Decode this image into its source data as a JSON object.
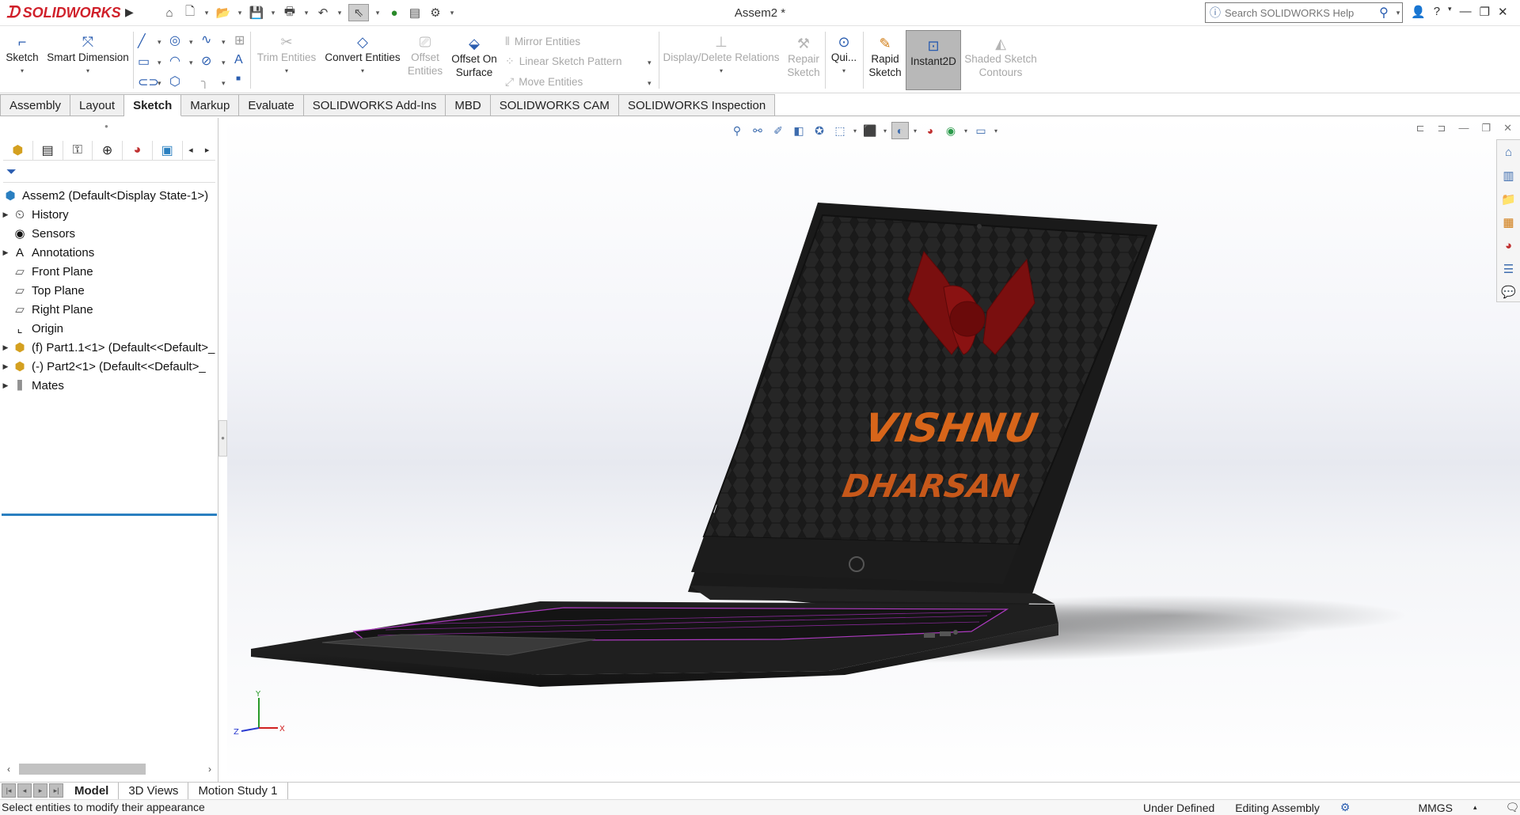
{
  "app": {
    "brand": "SOLIDWORKS",
    "document_title": "Assem2 *"
  },
  "search": {
    "placeholder": "Search SOLIDWORKS Help"
  },
  "ribbon": {
    "sketch": "Sketch",
    "smart_dimension": "Smart Dimension",
    "trim_entities": "Trim Entities",
    "convert_entities": "Convert Entities",
    "offset_entities": "Offset Entities",
    "offset_on_surface": "Offset On Surface",
    "mirror_entities": "Mirror Entities",
    "linear_sketch_pattern": "Linear Sketch Pattern",
    "move_entities": "Move Entities",
    "display_delete_relations": "Display/Delete Relations",
    "repair_sketch": "Repair Sketch",
    "quick_snaps": "Qui...",
    "rapid_sketch": "Rapid Sketch",
    "instant2d": "Instant2D",
    "shaded_sketch_contours": "Shaded Sketch Contours"
  },
  "tabs": [
    "Assembly",
    "Layout",
    "Sketch",
    "Markup",
    "Evaluate",
    "SOLIDWORKS Add-Ins",
    "MBD",
    "SOLIDWORKS CAM",
    "SOLIDWORKS Inspection"
  ],
  "active_tab": "Sketch",
  "tree": {
    "root": "Assem2  (Default<Display State-1>)",
    "items": [
      {
        "label": "History",
        "expand": true,
        "icon": "history-icon"
      },
      {
        "label": "Sensors",
        "expand": false,
        "icon": "sensor-icon"
      },
      {
        "label": "Annotations",
        "expand": true,
        "icon": "annotations-icon"
      },
      {
        "label": "Front Plane",
        "expand": false,
        "icon": "plane-icon"
      },
      {
        "label": "Top Plane",
        "expand": false,
        "icon": "plane-icon"
      },
      {
        "label": "Right Plane",
        "expand": false,
        "icon": "plane-icon"
      },
      {
        "label": "Origin",
        "expand": false,
        "icon": "origin-icon"
      },
      {
        "label": "(f) Part1.1<1> (Default<<Default>_",
        "expand": true,
        "icon": "part-icon"
      },
      {
        "label": "(-) Part2<1> (Default<<Default>_",
        "expand": true,
        "icon": "part-icon"
      },
      {
        "label": "Mates",
        "expand": true,
        "icon": "mates-icon"
      }
    ]
  },
  "model": {
    "screen_text_line1": "VISHNU",
    "screen_text_line2": "DHARSAN"
  },
  "triad": {
    "x": "X",
    "y": "Y",
    "z": "Z"
  },
  "bottom_tabs": [
    "Model",
    "3D Views",
    "Motion Study 1"
  ],
  "active_bottom_tab": "Model",
  "status": {
    "message": "Select entities to modify their appearance",
    "definition": "Under Defined",
    "mode": "Editing Assembly",
    "units": "MMGS"
  },
  "colors": {
    "accent": "#2a5db0",
    "brand_red": "#d0202a",
    "keyboard_glow": "#b43cc8",
    "logo_red": "#8a1010",
    "text_orange": "#d7651a"
  }
}
